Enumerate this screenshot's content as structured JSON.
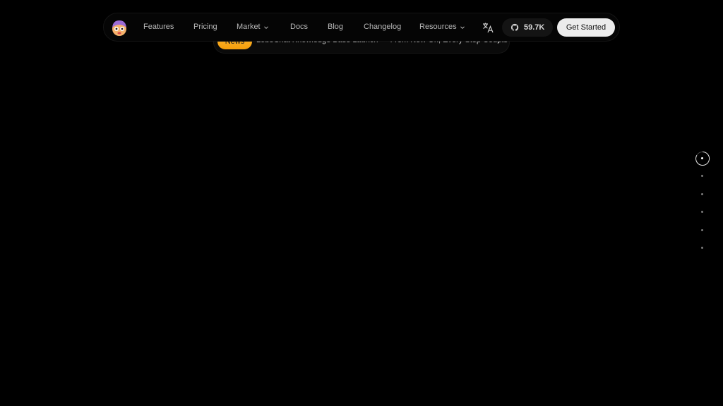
{
  "nav": {
    "logo_icon": "lobe-emoji-logo-icon",
    "items": [
      {
        "label": "Features",
        "has_dropdown": false
      },
      {
        "label": "Pricing",
        "has_dropdown": false
      },
      {
        "label": "Market",
        "has_dropdown": true
      },
      {
        "label": "Docs",
        "has_dropdown": false
      },
      {
        "label": "Blog",
        "has_dropdown": false
      },
      {
        "label": "Changelog",
        "has_dropdown": false
      },
      {
        "label": "Resources",
        "has_dropdown": true
      }
    ],
    "translate_icon": "translate-icon",
    "github_icon": "github-icon",
    "github_stars": "59.7K",
    "cta_label": "Get Started"
  },
  "banner": {
    "badge": "News",
    "text": "LobeChat Knowledge Base Launch — From Now On, Every Step Counts",
    "arrow_icon": "arrow-right-icon"
  },
  "section_nav": {
    "count": 6,
    "active_index": 0
  },
  "colors": {
    "background": "#000000",
    "badge": "#f59e0b",
    "cta_bg": "#ececec"
  }
}
